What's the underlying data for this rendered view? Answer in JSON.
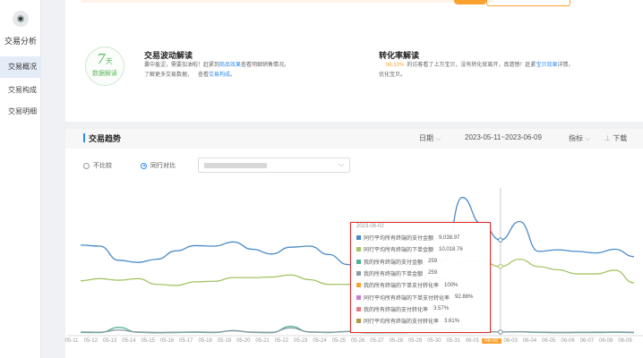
{
  "app": {
    "title": "交易分析"
  },
  "sidebar": {
    "items": [
      {
        "label": "交易概况",
        "active": true
      },
      {
        "label": "交易构成"
      },
      {
        "label": "交易明细"
      }
    ]
  },
  "badge": {
    "days": "7",
    "unit": "天",
    "caption": "数据解读"
  },
  "fluctuation": {
    "title": "交易波动解读",
    "line1_pre": "囊中羞涩，需要加油啦！赶紧到",
    "line1_link": "商品效果",
    "line1_post": "查看明细销售情况。",
    "line2_pre": "了解更多交易数据，",
    "line2_mid": "查看",
    "line2_link": "交易构成",
    "line2_post": "。"
  },
  "conversion": {
    "title": "转化率解读",
    "percent": "98.10%",
    "line1_pre": "的访客看了上万宝贝，没有转化就离开，真遗憾！赶紧",
    "line1_link": "宝贝效果",
    "line1_post": "详情，",
    "line2": "优化宝贝。"
  },
  "trend": {
    "title": "交易趋势",
    "date_label": "日期",
    "date_range": "2023-05-11~2023-06-09",
    "metric_label": "指标",
    "download_label": "下载",
    "compare_none": "不比较",
    "compare_peer": "同行对比"
  },
  "colors": {
    "blue": "#4a8ac8",
    "green": "#a3c464",
    "teal": "#53b39a",
    "gray": "#8a9aa8",
    "orange": "#fca130",
    "red": "#e02d2d"
  },
  "chart_data": {
    "type": "line",
    "x": [
      "05-11",
      "05-12",
      "05-13",
      "05-14",
      "05-15",
      "05-16",
      "05-17",
      "05-18",
      "05-19",
      "05-20",
      "05-21",
      "05-22",
      "05-23",
      "05-24",
      "05-25",
      "05-26",
      "05-27",
      "05-28",
      "05-29",
      "05-30",
      "05-31",
      "06-01",
      "06-02",
      "06-03",
      "06-04",
      "06-05",
      "06-06",
      "06-07",
      "06-08",
      "06-09"
    ],
    "highlighted_x": "06-02",
    "series": [
      {
        "color": "#4a8ac8",
        "values": [
          8550,
          8450,
          7100,
          6900,
          7200,
          8000,
          8500,
          8450,
          8850,
          8150,
          7700,
          8350,
          8450,
          7650,
          6700,
          6400,
          7150,
          7300,
          6900,
          7100,
          13100,
          10600,
          9039,
          10800,
          7950,
          8100,
          7950,
          7800,
          8150,
          7450
        ]
      },
      {
        "color": "#a3c464",
        "values": [
          5150,
          5350,
          5200,
          5350,
          4800,
          4700,
          5050,
          5100,
          5450,
          5450,
          5500,
          5700,
          5250,
          4800,
          4800,
          5350,
          5450,
          5650,
          5600,
          5400,
          6950,
          7000,
          6500,
          7200,
          6500,
          6200,
          5800,
          5800,
          6150,
          4950
        ]
      },
      {
        "color": "#53b39a",
        "values": [
          220,
          200,
          700,
          230,
          180,
          210,
          240,
          200,
          400,
          220,
          190,
          800,
          250,
          210,
          300,
          190,
          200,
          210,
          320,
          250,
          600,
          300,
          259,
          280,
          220,
          190,
          200,
          210,
          230,
          200
        ]
      },
      {
        "color": "#8a9aa8",
        "values": [
          260,
          240,
          450,
          260,
          220,
          240,
          270,
          240,
          380,
          250,
          230,
          650,
          270,
          240,
          320,
          230,
          240,
          250,
          330,
          280,
          500,
          320,
          259,
          300,
          250,
          230,
          240,
          250,
          260,
          240
        ]
      }
    ]
  },
  "tooltip": {
    "date": "2023-06-02",
    "rows": [
      {
        "label": "同行平均所有终端的支付金额",
        "value": "9,038.97",
        "color": "#4a8ac8"
      },
      {
        "label": "同行平均所有终端的下单金额",
        "value": "10,018.76",
        "color": "#a3c464"
      },
      {
        "label": "我的所有终端的支付金额",
        "value": "259",
        "color": "#53b39a"
      },
      {
        "label": "我的所有终端的下单金额",
        "value": "259",
        "color": "#8a9aa8"
      },
      {
        "label": "我的所有终端的下单支付转化率",
        "value": "100%",
        "color": "#fca130"
      },
      {
        "label": "同行平均所有终端的下单支付转化率",
        "value": "92.86%",
        "color": "#c77dd1"
      },
      {
        "label": "我的所有终端的支付转化率",
        "value": "3.57%",
        "color": "#e87d8a"
      },
      {
        "label": "同行平均所有终端的支付转化率",
        "value": "3.61%",
        "color": "#b09a4a"
      }
    ]
  }
}
